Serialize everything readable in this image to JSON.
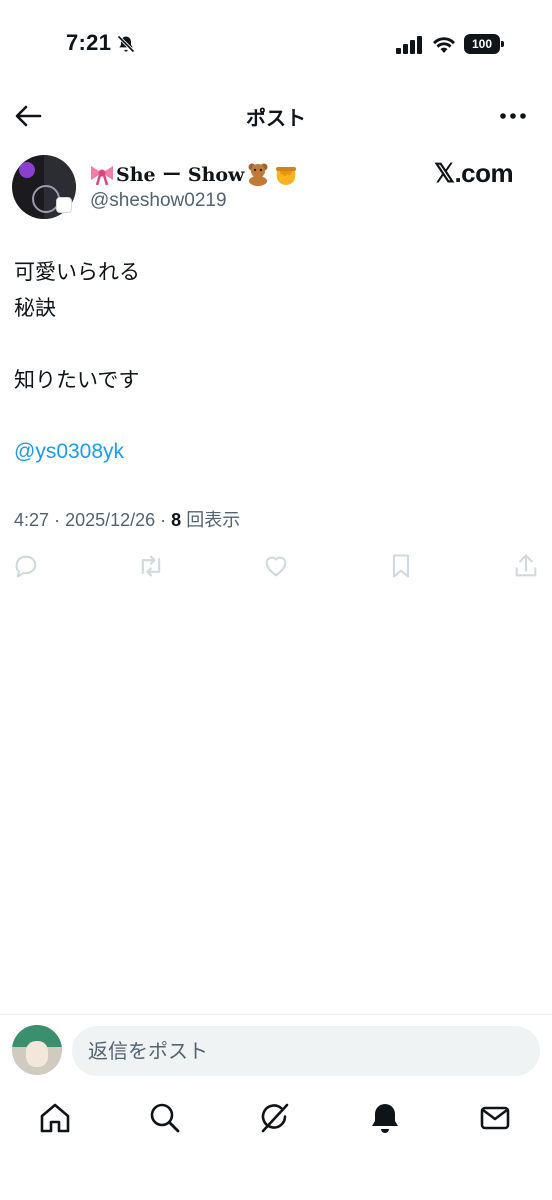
{
  "status_bar": {
    "time": "7:21",
    "battery": "100",
    "icons": [
      "bell-slash-icon",
      "signal-icon",
      "wifi-icon",
      "battery-icon"
    ]
  },
  "header": {
    "title": "ポスト",
    "back_icon": "arrow-left-icon",
    "more_icon": "more-horizontal-icon"
  },
  "author": {
    "display_name": "She ー Show",
    "handle": "@sheshow0219",
    "emojis": [
      "ribbon-emoji",
      "teddy-bear-emoji",
      "honey-pot-emoji"
    ],
    "watermark": "𝕏.com"
  },
  "post": {
    "lines": [
      "可愛いられる",
      "秘訣",
      "",
      "知りたいです",
      "",
      "@ys0308yk"
    ],
    "time": "4:27",
    "date": "2025/12/26",
    "views_count": "8",
    "views_label": "回表示"
  },
  "actions": [
    "reply-icon",
    "repost-icon",
    "like-icon",
    "bookmark-icon",
    "share-icon"
  ],
  "reply": {
    "placeholder": "返信をポスト"
  },
  "nav": [
    "home-icon",
    "search-icon",
    "grok-icon",
    "notifications-icon",
    "messages-icon"
  ],
  "colors": {
    "accent": "#1d9bf0",
    "text": "#0f1419",
    "secondary": "#536471",
    "icon_muted": "#cfd9de",
    "input_bg": "#eff3f4"
  }
}
